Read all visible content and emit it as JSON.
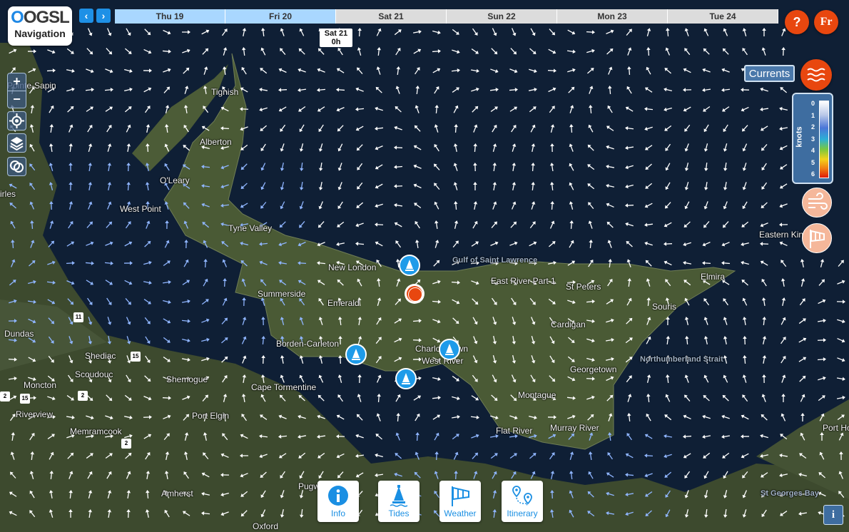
{
  "brand": {
    "logo_top": "OGSL",
    "logo_bottom": "Navigation"
  },
  "timeline": {
    "prev": "‹",
    "next": "›",
    "days": [
      {
        "label": "Thu 19",
        "state": "past"
      },
      {
        "label": "Fri 20",
        "state": "past"
      },
      {
        "label": "Sat 21",
        "state": "future"
      },
      {
        "label": "Sun 22",
        "state": "future"
      },
      {
        "label": "Mon 23",
        "state": "future"
      },
      {
        "label": "Tue 24",
        "state": "future"
      }
    ],
    "current_day": "Sat 21",
    "current_hour": "0h"
  },
  "top_right": {
    "help": "?",
    "language": "Fr"
  },
  "zoom": {
    "in": "+",
    "out": "−"
  },
  "layer_panel": {
    "active_layer": "Currents",
    "legend_unit": "knots",
    "legend_ticks": [
      "0",
      "1",
      "2",
      "3",
      "4",
      "5",
      "6"
    ]
  },
  "dock": {
    "info": "Info",
    "tides": "Tides",
    "weather": "Weather",
    "itinerary": "Itinerary"
  },
  "corner_info": "i",
  "colors": {
    "accent_orange": "#e8470f",
    "accent_blue": "#1e90e6",
    "water": "#0f1f35",
    "land": "#3b4a2c"
  },
  "places": [
    "Pointe-Sapin",
    "Tignish",
    "Alberton",
    "O'Leary",
    "West Point",
    "Tyne Valley",
    "New London",
    "Summerside",
    "Emerald",
    "Borden-Carleton",
    "Charlottetown",
    "West River",
    "Cape Tormentine",
    "Gulf of Saint Lawrence",
    "East River Part 1",
    "St Peters",
    "Elmira",
    "Souris",
    "Cardigan",
    "Georgetown",
    "Northumberland Strait",
    "Montague",
    "Murray River",
    "Flat River",
    "Eastern Kings",
    "Moncton",
    "Riverview",
    "Dundas",
    "Shediac",
    "Scoudouc",
    "Shemogue",
    "Port Elgin",
    "Memramcook",
    "Amherst",
    "Oxford",
    "Pugwash",
    "St Georges Bay",
    "Port Hood",
    "irles"
  ],
  "road_shields": [
    "11",
    "15",
    "2",
    "15",
    "2",
    "2"
  ]
}
